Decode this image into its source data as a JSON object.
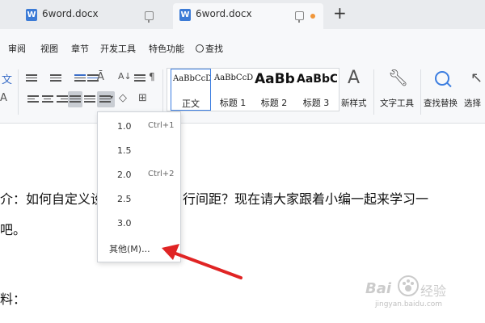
{
  "tabs": [
    {
      "title": "6word.docx"
    },
    {
      "title": "6word.docx"
    }
  ],
  "newtab_symbol": "+",
  "menu": {
    "items": [
      "审阅",
      "视图",
      "章节",
      "开发工具",
      "特色功能"
    ],
    "search": "查找"
  },
  "ribbon": {
    "left_partial_char": "文",
    "left_partial_char2": "A",
    "styles": [
      {
        "sample": "AaBbCcDd",
        "name": "正文"
      },
      {
        "sample": "AaBbCcDd",
        "name": "标题 1"
      },
      {
        "sample": "AaBb(",
        "name": "标题 2"
      },
      {
        "sample": "AaBbC(",
        "name": "标题 3"
      }
    ],
    "new_style": "新样式",
    "text_tools": "文字工具",
    "find_replace": "查找替换",
    "select": "选择"
  },
  "document": {
    "line1_left": "介：如何自定义设",
    "line1_right": "行间距？现在请大家跟着小编一起来学习一",
    "line2": "吧。",
    "line3": "料："
  },
  "line_spacing_menu": {
    "items": [
      {
        "value": "1.0",
        "shortcut": "Ctrl+1"
      },
      {
        "value": "1.5",
        "shortcut": ""
      },
      {
        "value": "2.0",
        "shortcut": "Ctrl+2"
      },
      {
        "value": "2.5",
        "shortcut": ""
      },
      {
        "value": "3.0",
        "shortcut": ""
      },
      {
        "value": "其他(M)...",
        "shortcut": ""
      }
    ]
  },
  "watermark": {
    "brand": "Bai",
    "brand2": "经验",
    "url": "jingyan.baidu.com"
  },
  "colors": {
    "accent": "#3b7de0",
    "arrow": "#e02424",
    "tab_icon": "#3c7bd6",
    "unsaved_dot": "#f0963a"
  }
}
